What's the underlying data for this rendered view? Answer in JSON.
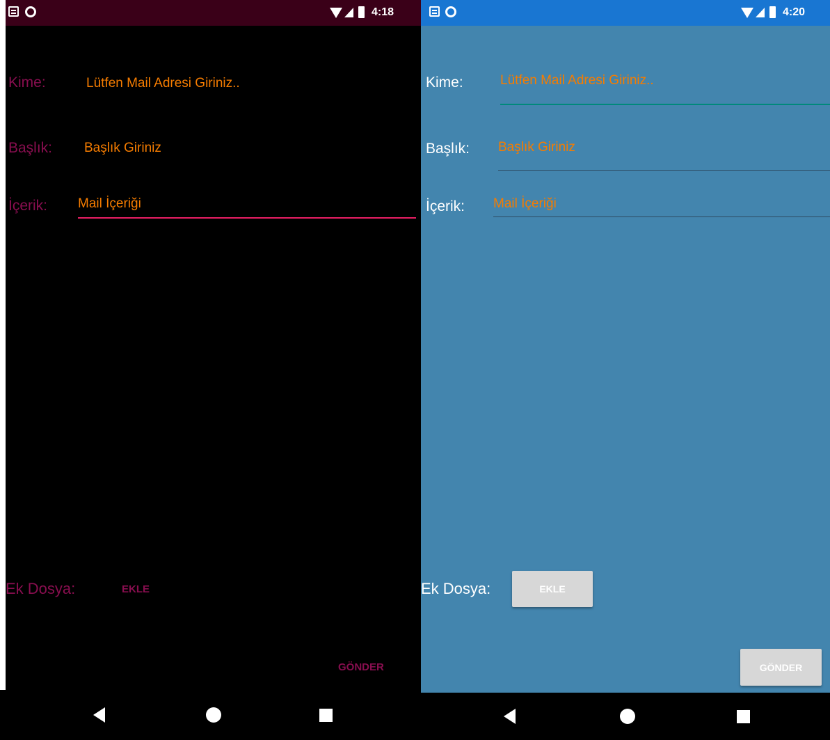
{
  "left_screen": {
    "status": {
      "time": "4:18",
      "icons": [
        "notification-icon",
        "sync-circle-icon",
        "wifi-icon",
        "signal-icon",
        "battery-icon"
      ]
    },
    "form": {
      "to_label": "Kime:",
      "to_placeholder": "Lütfen Mail Adresi Giriniz..",
      "subject_label": "Başlık:",
      "subject_placeholder": "Başlık Giriniz",
      "body_label": "İçerik:",
      "body_placeholder": "Mail İçeriği",
      "attachment_label": "Ek Dosya:",
      "add_button": "EKLE",
      "send_button": "GÖNDER"
    },
    "colors": {
      "background": "#000000",
      "label": "#880e4f",
      "hint": "#f57c00",
      "underline": "#e91e63",
      "statusbar": "#3a0018"
    }
  },
  "right_screen": {
    "status": {
      "time": "4:20",
      "icons": [
        "notification-icon",
        "sync-circle-icon",
        "wifi-icon",
        "signal-icon",
        "battery-icon"
      ]
    },
    "form": {
      "to_label": "Kime:",
      "to_placeholder": "Lütfen Mail Adresi Giriniz..",
      "subject_label": "Başlık:",
      "subject_placeholder": "Başlık Giriniz",
      "body_label": "İçerik:",
      "body_placeholder": "Mail İçeriği",
      "attachment_label": "Ek Dosya:",
      "add_button": "EKLE",
      "send_button": "GÖNDER"
    },
    "colors": {
      "background": "#4385ae",
      "label": "#ffffff",
      "hint": "#f57c00",
      "focused_underline": "#00897b",
      "underline": "#2d4a62",
      "statusbar": "#1976d2"
    }
  },
  "navigation": {
    "buttons": [
      "back-icon",
      "home-icon",
      "recents-icon"
    ]
  }
}
